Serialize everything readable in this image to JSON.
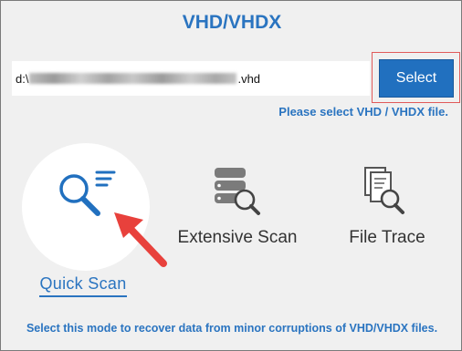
{
  "header": {
    "title": "VHD/VHDX"
  },
  "path": {
    "prefix": "d:\\",
    "suffix": ".vhd"
  },
  "select_button": {
    "label": "Select"
  },
  "hint": "Please select VHD / VHDX file.",
  "modes": [
    {
      "label": "Quick Scan",
      "icon": "quick-scan-search-icon",
      "selected": true
    },
    {
      "label": "Extensive Scan",
      "icon": "database-search-icon",
      "selected": false
    },
    {
      "label": "File Trace",
      "icon": "document-search-icon",
      "selected": false
    }
  ],
  "description": "Select this mode to recover data from minor corruptions of VHD/VHDX files.",
  "colors": {
    "accent": "#2a74c0",
    "button": "#2170bf",
    "highlight": "#e05a5a",
    "arrow": "#e8413c"
  }
}
